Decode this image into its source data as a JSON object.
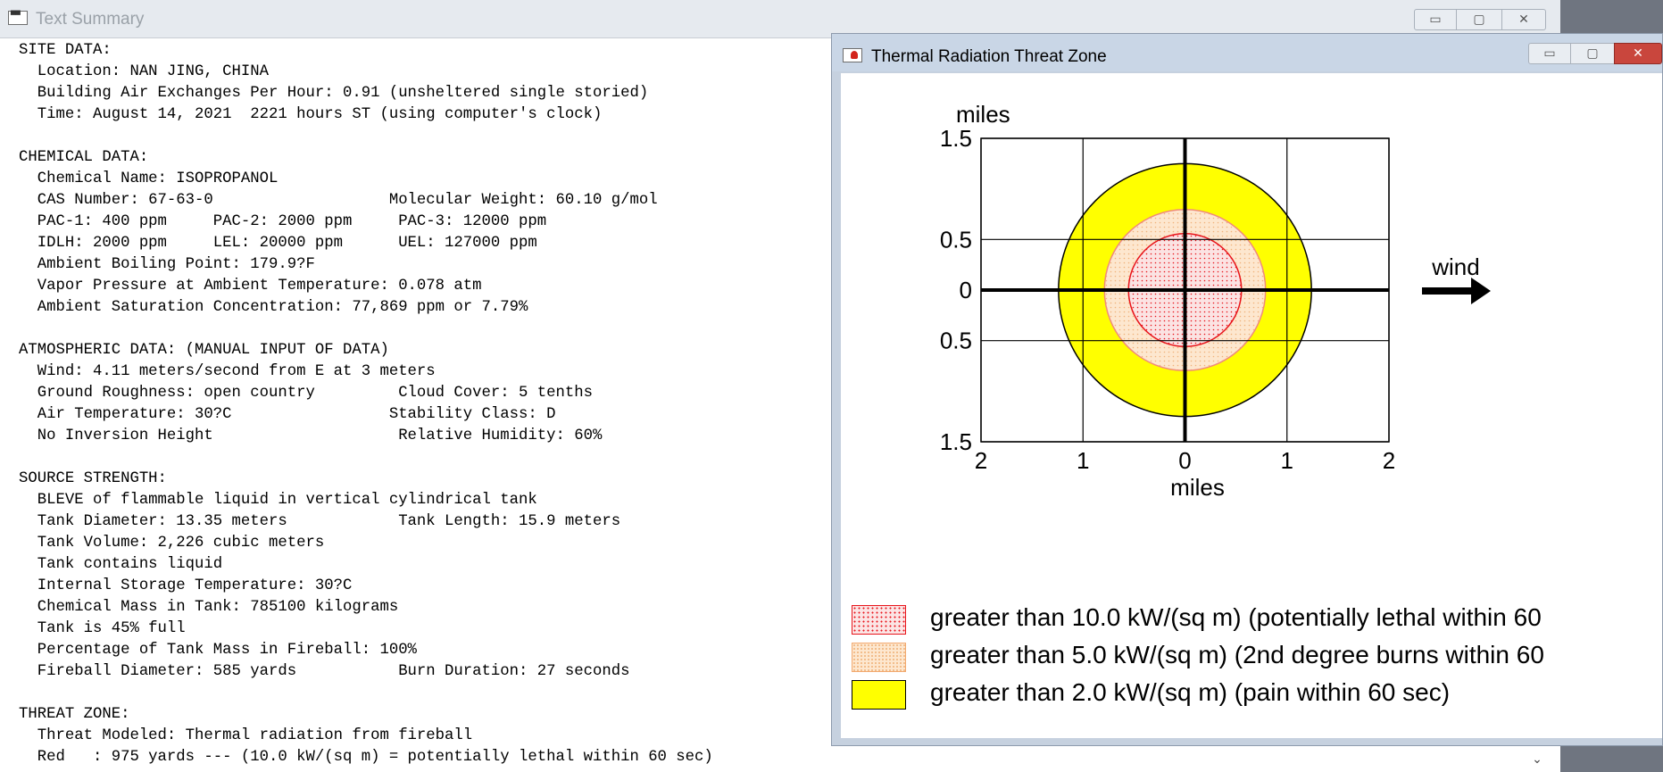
{
  "text_window": {
    "title": "Text Summary",
    "title_icon": "window-icon",
    "buttons": {
      "minimize": "▭",
      "maximize": "▢",
      "close": "✕"
    }
  },
  "summary_lines": [
    "SITE DATA:",
    "  Location: NAN JING, CHINA",
    "  Building Air Exchanges Per Hour: 0.91 (unsheltered single storied)",
    "  Time: August 14, 2021  2221 hours ST (using computer's clock)",
    "",
    "CHEMICAL DATA:",
    "  Chemical Name: ISOPROPANOL",
    "  CAS Number: 67-63-0                   Molecular Weight: 60.10 g/mol",
    "  PAC-1: 400 ppm     PAC-2: 2000 ppm     PAC-3: 12000 ppm",
    "  IDLH: 2000 ppm     LEL: 20000 ppm      UEL: 127000 ppm",
    "  Ambient Boiling Point: 179.9?F",
    "  Vapor Pressure at Ambient Temperature: 0.078 atm",
    "  Ambient Saturation Concentration: 77,869 ppm or 7.79%",
    "",
    "ATMOSPHERIC DATA: (MANUAL INPUT OF DATA)",
    "  Wind: 4.11 meters/second from E at 3 meters",
    "  Ground Roughness: open country         Cloud Cover: 5 tenths",
    "  Air Temperature: 30?C                 Stability Class: D",
    "  No Inversion Height                    Relative Humidity: 60%",
    "",
    "SOURCE STRENGTH:",
    "  BLEVE of flammable liquid in vertical cylindrical tank",
    "  Tank Diameter: 13.35 meters            Tank Length: 15.9 meters",
    "  Tank Volume: 2,226 cubic meters",
    "  Tank contains liquid",
    "  Internal Storage Temperature: 30?C",
    "  Chemical Mass in Tank: 785100 kilograms",
    "  Tank is 45% full",
    "  Percentage of Tank Mass in Fireball: 100%",
    "  Fireball Diameter: 585 yards           Burn Duration: 27 seconds",
    "",
    "THREAT ZONE:",
    "  Threat Modeled: Thermal radiation from fireball",
    "  Red   : 975 yards --- (10.0 kW/(sq m) = potentially lethal within 60 sec)"
  ],
  "thermal_window": {
    "title": "Thermal Radiation Threat Zone",
    "title_icon": "threat-zone-icon",
    "buttons": {
      "minimize": "▭",
      "maximize": "▢",
      "close": "✕"
    },
    "wind_label": "wind",
    "wind_icon": "arrow-right-icon",
    "legend": [
      {
        "id": "red",
        "text": "greater than 10.0 kW/(sq m) (potentially lethal within 60",
        "color": "#e8141a"
      },
      {
        "id": "orange",
        "text": "greater than 5.0 kW/(sq m) (2nd degree burns within 60",
        "color": "#f5b57d"
      },
      {
        "id": "yellow",
        "text": "greater than 2.0 kW/(sq m) (pain within 60 sec)",
        "color": "#ffff00"
      }
    ]
  },
  "chart_data": {
    "type": "area",
    "title": "",
    "ylabel": "miles",
    "xlabel": "miles",
    "x_ticks": [
      {
        "v": -2,
        "label": "2"
      },
      {
        "v": -1,
        "label": "1"
      },
      {
        "v": 0,
        "label": "0"
      },
      {
        "v": 1,
        "label": "1"
      },
      {
        "v": 2,
        "label": "2"
      }
    ],
    "y_ticks": [
      {
        "v": 1.5,
        "label": "1.5"
      },
      {
        "v": 0.5,
        "label": "0.5"
      },
      {
        "v": 0,
        "label": "0"
      },
      {
        "v": -0.5,
        "label": "0.5"
      },
      {
        "v": -1.5,
        "label": "1.5"
      }
    ],
    "xlim": [
      -2,
      2
    ],
    "ylim": [
      -1.5,
      1.5
    ],
    "grid": true,
    "zones": [
      {
        "name": "yellow",
        "radius_miles": 1.24,
        "fill": "#ffff00",
        "stroke": "#000000"
      },
      {
        "name": "orange",
        "radius_miles": 0.79,
        "fill": "#fde7cf",
        "stroke": "#f08a7a",
        "dot": "#f0b27a"
      },
      {
        "name": "red",
        "radius_miles": 0.554,
        "fill": "#fbe3e3",
        "stroke": "#e8141a",
        "dot": "#e8141a"
      }
    ]
  }
}
